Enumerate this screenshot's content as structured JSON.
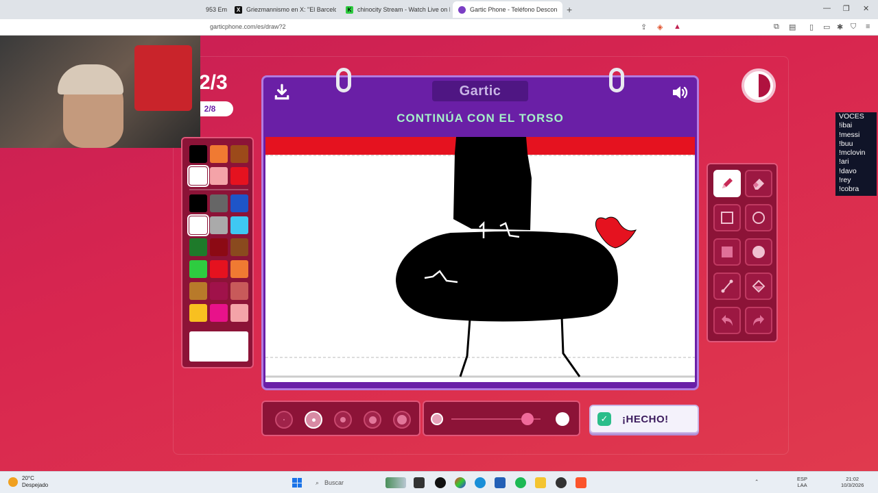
{
  "browser": {
    "tabs": [
      {
        "title": "953 Em",
        "favicon_color": "#d04030",
        "active": false
      },
      {
        "title": "Griezmannismo en X: \"El Barcelona n",
        "favicon_color": "#111111",
        "favicon_glyph": "X",
        "active": false
      },
      {
        "title": "chinocity Stream - Watch Live on Kick",
        "favicon_color": "#2ecc40",
        "favicon_glyph": "K",
        "active": false
      },
      {
        "title": "Gartic Phone - Teléfono Descon",
        "favicon_color": "#7b3fc4",
        "active": true
      }
    ],
    "new_tab_label": "+",
    "url": "garticphone.com/es/draw?2"
  },
  "game": {
    "round_big": "2/3",
    "round_pill": "2/8",
    "logo": "Gartic",
    "instruction": "CONTINÚA CON EL TORSO",
    "done_button": "¡HECHO!",
    "palette": {
      "colors": [
        "#000000",
        "#f07a32",
        "#9c4a1a",
        "#ffffff",
        "#f4a3a8",
        "#e5121f",
        "#000000",
        "#666666",
        "#1e55c8",
        "#ffffff",
        "#aaaaaa",
        "#3fc8f2",
        "#1e7a2a",
        "#8c0a14",
        "#8a4a1e",
        "#2ecc40",
        "#e5121f",
        "#f07a32",
        "#b87a2a",
        "#a0124a",
        "#c85a5a",
        "#f8c020",
        "#e8128a",
        "#f4a3a8"
      ],
      "selected_index": 3,
      "current_color": "#ffffff"
    },
    "tools": [
      "pencil-tool",
      "eraser-tool",
      "rectangle-outline-tool",
      "ellipse-outline-tool",
      "rectangle-fill-tool",
      "ellipse-fill-tool",
      "line-tool",
      "fill-bucket-tool",
      "undo-tool",
      "redo-tool"
    ],
    "active_tool": "pencil-tool",
    "brush_sizes": [
      "size-1",
      "size-2",
      "size-3",
      "size-4",
      "size-5"
    ],
    "selected_brush_size": 2,
    "opacity_level": 0.85
  },
  "voces_overlay": {
    "title": "VOCES",
    "items": [
      "!ibai",
      "!messi",
      "!buu",
      "!mclovin",
      "!ari",
      "!davo",
      "!rey",
      "!cobra"
    ]
  },
  "taskbar": {
    "weather_temp": "20°C",
    "weather_desc": "Despejado",
    "search_placeholder": "Buscar",
    "lang_1": "ESP",
    "lang_2": "LAA",
    "time": "21:02",
    "date": "10/3/2026"
  }
}
